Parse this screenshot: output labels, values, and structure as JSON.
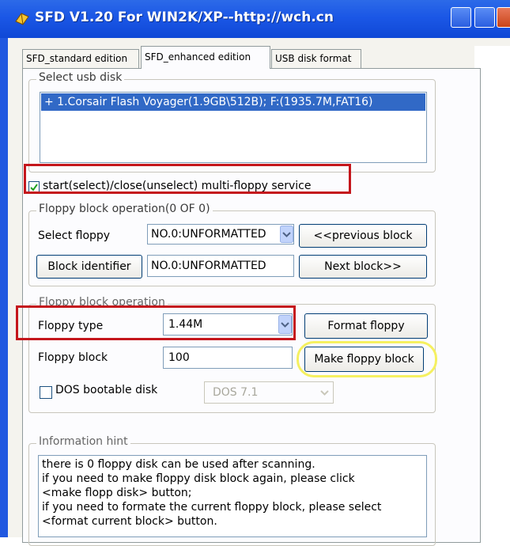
{
  "window": {
    "title": "SFD V1.20 For WIN2K/XP--http://wch.cn"
  },
  "tabs": [
    {
      "label": "SFD_standard edition"
    },
    {
      "label": "SFD_enhanced edition"
    },
    {
      "label": "USB disk format"
    }
  ],
  "usb_group": {
    "legend": "Select usb disk",
    "items": [
      "+ 1.Corsair Flash Voyager(1.9GB\\512B); F:(1935.7M,FAT16)"
    ]
  },
  "multi_floppy": {
    "label": "start(select)/close(unselect) multi-floppy service",
    "checked": true
  },
  "block_operation": {
    "legend": "Floppy block operation(0 OF 0)",
    "select_floppy_label": "Select floppy",
    "select_floppy_value": "NO.0:UNFORMATTED",
    "previous_button": "<<previous block",
    "block_identifier_button": "Block identifier",
    "block_identifier_value": "NO.0:UNFORMATTED",
    "next_button": "Next block>>"
  },
  "floppy_operation": {
    "legend": "Floppy block operation",
    "floppy_type_label": "Floppy type",
    "floppy_type_value": "1.44M",
    "format_button": "Format floppy",
    "floppy_block_label": "Floppy block",
    "floppy_block_value": "100",
    "make_button": "Make floppy block",
    "dos_bootable_label": "DOS bootable disk",
    "dos_bootable_checked": false,
    "dos_version": "DOS 7.1"
  },
  "info": {
    "legend": "Information hint",
    "lines": [
      "there is 0 floppy disk can be used after scanning.",
      " if you need to make floppy disk block again, please click",
      "<make flopp disk> button;",
      " if you need to formate the current floppy block, please select",
      "<format current block> button."
    ]
  },
  "colors": {
    "title_bar": "#1b57e6",
    "highlight_red": "#c4161c",
    "highlight_yellow": "#f5f060",
    "selection_blue": "#3169c6"
  }
}
